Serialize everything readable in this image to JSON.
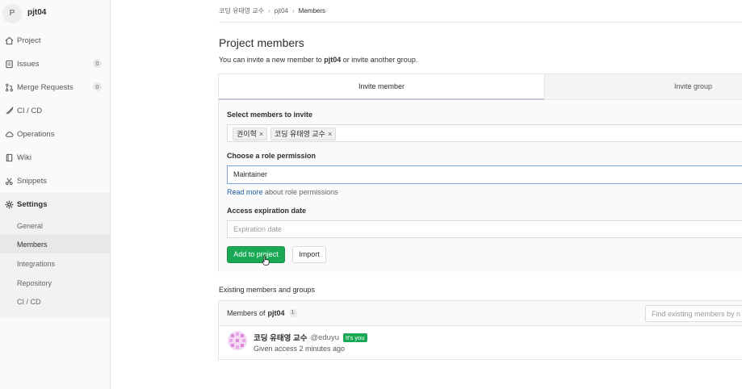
{
  "project": {
    "avatar_letter": "P",
    "name": "pjt04"
  },
  "sidebar": {
    "items": [
      {
        "label": "Project",
        "icon": "home-icon"
      },
      {
        "label": "Issues",
        "icon": "issues-icon",
        "badge": "0"
      },
      {
        "label": "Merge Requests",
        "icon": "merge-request-icon",
        "badge": "0"
      },
      {
        "label": "CI / CD",
        "icon": "rocket-icon"
      },
      {
        "label": "Operations",
        "icon": "cloud-gear-icon"
      },
      {
        "label": "Wiki",
        "icon": "book-icon"
      },
      {
        "label": "Snippets",
        "icon": "scissors-icon"
      },
      {
        "label": "Settings",
        "icon": "gear-icon"
      }
    ],
    "settings_sub": [
      "General",
      "Members",
      "Integrations",
      "Repository",
      "CI / CD"
    ],
    "active_sub": "Members"
  },
  "breadcrumb": {
    "group": "코딩 유태영 교수",
    "project": "pjt04",
    "current": "Members"
  },
  "page": {
    "title": "Project members",
    "desc_prefix": "You can invite a new member to ",
    "desc_project": "pjt04",
    "desc_suffix": " or invite another group."
  },
  "tabs": {
    "invite_member": "Invite member",
    "invite_group": "Invite group"
  },
  "form": {
    "select_label": "Select members to invite",
    "tokens": [
      "권이혁",
      "코딩 유태영 교수"
    ],
    "role_label": "Choose a role permission",
    "role_value": "Maintainer",
    "help_link": "Read more",
    "help_text": " about role permissions",
    "expiration_label": "Access expiration date",
    "expiration_placeholder": "Expiration date",
    "add_button": "Add to project",
    "import_button": "Import"
  },
  "existing": {
    "title": "Existing members and groups",
    "members_of": "Members of",
    "project": "pjt04",
    "count": "1",
    "filter_placeholder": "Find existing members by name",
    "member": {
      "name": "코딩 유태영 교수",
      "username": "@eduyu",
      "badge": "It's you",
      "access": "Given access 2 minutes ago"
    }
  },
  "colors": {
    "primary_green": "#1aaa55",
    "link_blue": "#1f5fa8",
    "focus_border": "#7aa6dd"
  }
}
